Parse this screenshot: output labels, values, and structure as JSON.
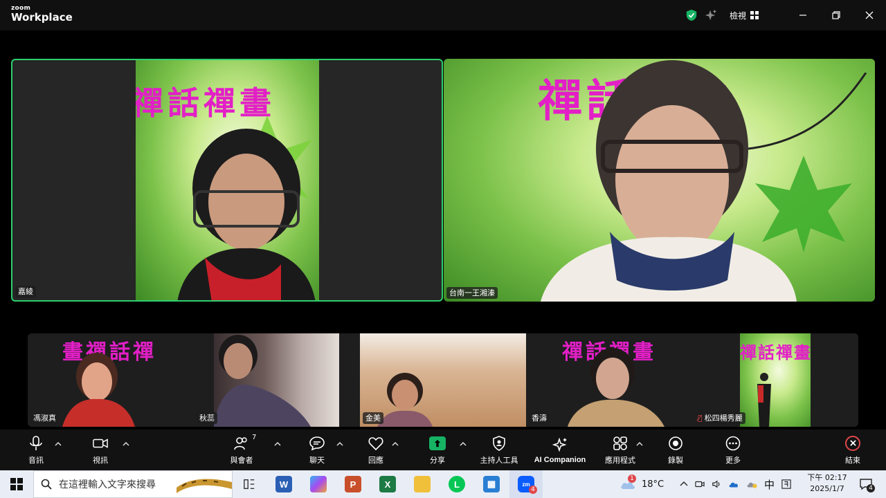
{
  "window": {
    "brand_small": "zoom",
    "brand_big": "Workplace",
    "view_label": "檢視",
    "icons": [
      "shield-check-icon",
      "sparkle-icon",
      "grid-icon",
      "minimize-icon",
      "restore-icon",
      "close-icon"
    ],
    "accent_green": "#2ed06e"
  },
  "main_videos": [
    {
      "name": "嘉綾",
      "banner": "禪話禪畫",
      "active_speaker": true
    },
    {
      "name": "台南一王湘溱",
      "banner": "禪話禪畫"
    }
  ],
  "gallery": [
    {
      "name": "馮淑真",
      "banner": "畫禪話禪"
    },
    {
      "name": "秋蕊"
    },
    {
      "name": "金美"
    },
    {
      "name": "香濤",
      "banner": "禪話禪畫"
    },
    {
      "name": "松四楊秀麗",
      "banner": "禪話禪畫",
      "muted": true
    }
  ],
  "toolbar": {
    "audio": "音訊",
    "video": "視訊",
    "participants": "與會者",
    "participants_count": "7",
    "chat": "聊天",
    "react": "回應",
    "share": "分享",
    "host_tools": "主持人工具",
    "ai_companion": "AI Companion",
    "apps": "應用程式",
    "record": "錄製",
    "more": "更多",
    "end": "結束",
    "end_color": "#e0474b",
    "share_color": "#16b364"
  },
  "taskbar": {
    "search_placeholder": "在這裡輸入文字來搜尋",
    "weather": "18°C",
    "weather_badge": "1",
    "ime": "中",
    "time": "下午 02:17",
    "date": "2025/1/7",
    "notifications": "4",
    "zoom_badge": "4",
    "apps": [
      "task-view",
      "word",
      "copilot",
      "powerpoint",
      "excel",
      "file-explorer",
      "line",
      "store",
      "zoom"
    ]
  }
}
